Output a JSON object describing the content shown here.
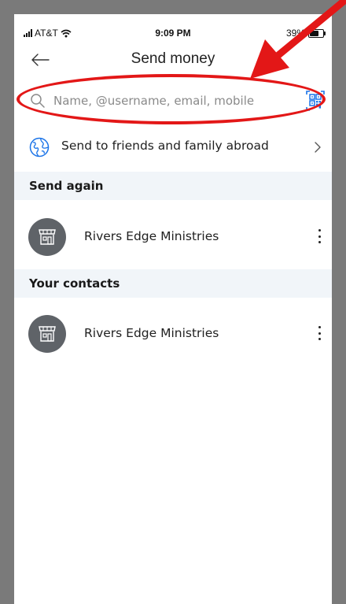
{
  "status_bar": {
    "carrier": "AT&T",
    "time": "9:09 PM",
    "battery": "39%"
  },
  "header": {
    "title": "Send money",
    "back_icon": "arrow-left-icon"
  },
  "search": {
    "placeholder": "Name, @username, email, mobile",
    "value": "",
    "icon": "search-icon",
    "qr_icon": "qr-code-icon"
  },
  "abroad": {
    "label": "Send to friends and family abroad",
    "icon": "globe-icon"
  },
  "send_again": {
    "heading": "Send again",
    "items": [
      {
        "name": "Rivers Edge Ministries"
      }
    ]
  },
  "contacts": {
    "heading": "Your contacts",
    "items": [
      {
        "name": "Rivers Edge Ministries"
      }
    ]
  },
  "colors": {
    "annotation_red": "#e31717",
    "qr_blue": "#1a73e8",
    "section_bg": "#f1f5f9",
    "avatar_bg": "#5f6368"
  }
}
